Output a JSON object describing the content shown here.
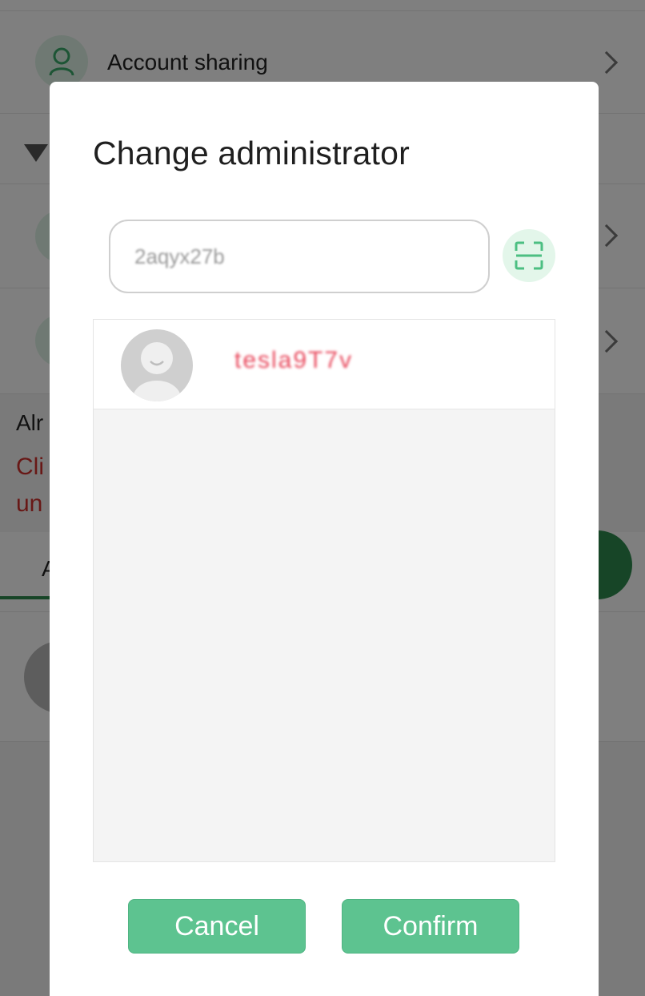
{
  "background": {
    "account_sharing_label": "Account sharing",
    "partial_label_1": "Alr",
    "partial_red_1": "Cli",
    "partial_red_2": "un",
    "partial_tab": "A"
  },
  "dialog": {
    "title": "Change administrator",
    "search_value": "2aqyx27b",
    "scan_icon": "scan-icon",
    "results": [
      {
        "name": "tesla9T7v"
      }
    ],
    "cancel_label": "Cancel",
    "confirm_label": "Confirm"
  },
  "colors": {
    "accent": "#5dc390",
    "accent_dark": "#2f8a4f",
    "danger": "#e8485c"
  }
}
